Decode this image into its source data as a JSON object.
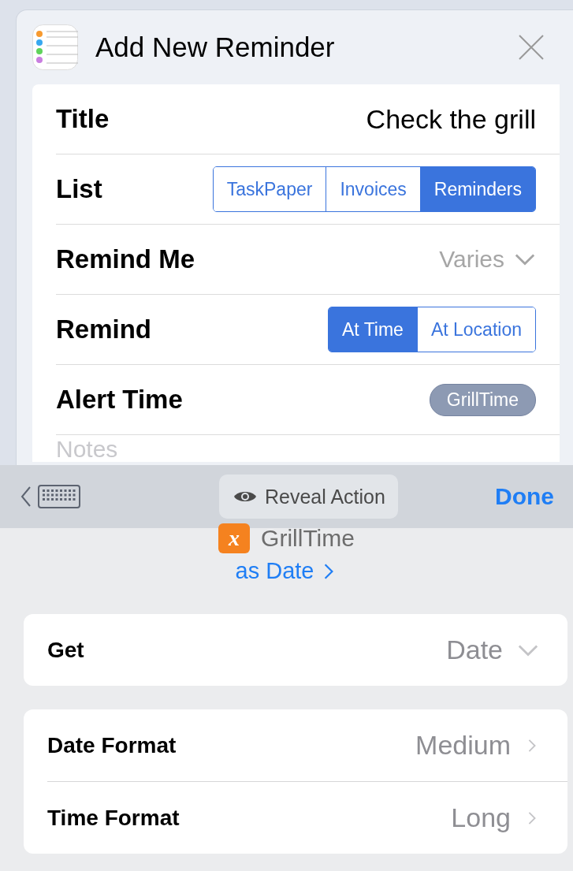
{
  "sheet": {
    "title": "Add New Reminder"
  },
  "fields": [
    {
      "kind": "text",
      "label": "Title",
      "value": "Check the grill"
    },
    {
      "kind": "segments",
      "label": "List",
      "options": [
        {
          "label": "TaskPaper",
          "selected": false
        },
        {
          "label": "Invoices",
          "selected": false
        },
        {
          "label": "Reminders",
          "selected": true
        }
      ]
    },
    {
      "kind": "dropdown",
      "label": "Remind Me",
      "value": "Varies"
    },
    {
      "kind": "segments",
      "label": "Remind",
      "options": [
        {
          "label": "At Time",
          "selected": true
        },
        {
          "label": "At Location",
          "selected": false
        }
      ]
    },
    {
      "kind": "token",
      "label": "Alert Time",
      "value": "GrillTime"
    }
  ],
  "notes": {
    "placeholder": "Notes"
  },
  "toolbar": {
    "reveal": "Reveal Action",
    "done": "Done"
  },
  "variable": {
    "name": "GrillTime",
    "glyph": "x",
    "type_link": "as Date"
  },
  "groups": [
    [
      {
        "kind": "dropdown",
        "label": "Get",
        "value": "Date"
      }
    ],
    [
      {
        "kind": "link",
        "label": "Date Format",
        "value": "Medium"
      },
      {
        "kind": "link",
        "label": "Time Format",
        "value": "Long"
      }
    ]
  ]
}
